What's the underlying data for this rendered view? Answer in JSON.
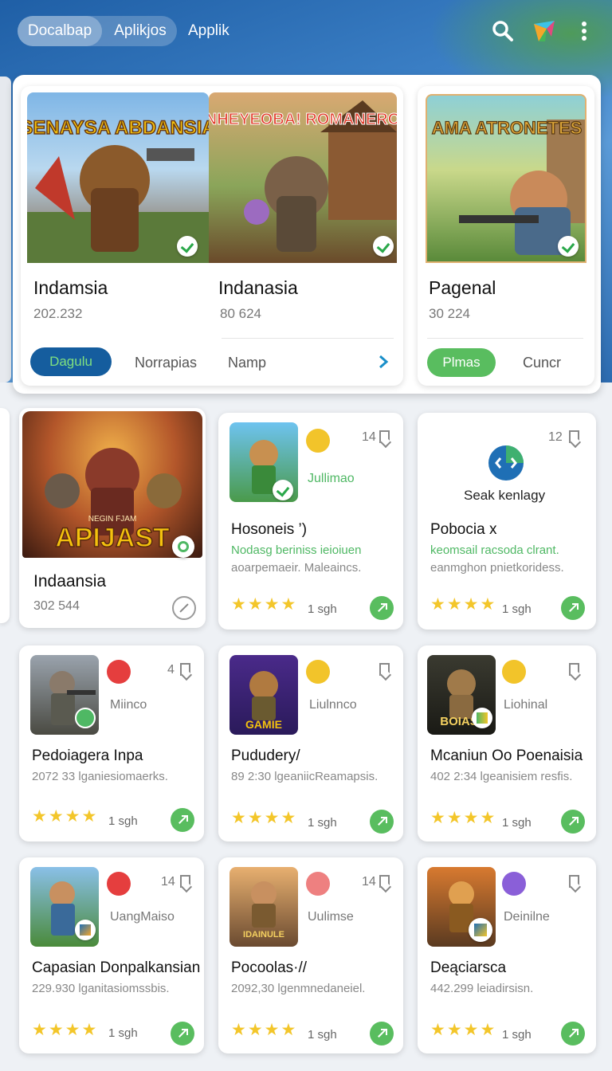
{
  "topbar": {
    "tab1": "Docalbap",
    "tab2": "Aplikjos",
    "tab3": "Applik",
    "icons": [
      "search-icon",
      "brand-icon",
      "more-icon"
    ]
  },
  "hero": {
    "items": [
      {
        "art_title": "SENAYSA ABDANSIA",
        "title": "Indamsia",
        "num": "202.232"
      },
      {
        "art_title": "NHEYEOBA! ROMANERO",
        "title": "Indanasia",
        "num": "80 624"
      },
      {
        "art_title": "AMA ATRONETES",
        "title": "Pagenal",
        "num": "30 224"
      }
    ],
    "actions": {
      "primary": "Dagulu",
      "link1": "Norrapias",
      "link2": "Namp",
      "primary2": "Plmas",
      "link3": "Cuncr"
    }
  },
  "featured": {
    "art_title": "APIJAST",
    "art_sub": "NEGIN FJAM",
    "title": "Indaansia",
    "num": "302 544"
  },
  "cards": [
    {
      "count": "14",
      "category": "Jullimao",
      "name": "Hosoneis ’)",
      "desc1": "Nodasg beriniss ieioiuen",
      "desc2": "aoarpemaeir. Maleaincs.",
      "ago": "1 sgh",
      "dot": "#f2c42a"
    },
    {
      "count": "12",
      "category": "Seak kenlagy",
      "name": "Pobocia x",
      "desc1": "keomsail racsoda clrant.",
      "desc2": "eanmghon pnietkoridess.",
      "ago": "1 sgh",
      "dot": "#1f6fb5"
    },
    {
      "count": "4",
      "category": "Miinco",
      "name": "Pedoiagera Inpa",
      "desc2": "2072 33 lganiesiomaerks.",
      "ago": "1 sgh",
      "dot": "#e53e3e"
    },
    {
      "count": "",
      "category": "Liulnnco",
      "name": "Pududery/",
      "desc2": "89 2:30 lgeaniicReamapsis.",
      "ago": "1 sgh",
      "dot": "#f2c42a",
      "art_title": "GAMIE"
    },
    {
      "count": "",
      "category": "Liohinal",
      "name": "Mcaniun Oo Poenaisia",
      "desc2": "402 2:34 lgeanisiem resfis.",
      "ago": "1 sgh",
      "dot": "#f2c42a",
      "art_title": "BOIAS"
    },
    {
      "count": "14",
      "category": "UangMaiso",
      "name": "Capasian Donpalkansian",
      "desc2": "229.930 lganitasiomssbis.",
      "ago": "1 sgh",
      "dot": "#e53e3e"
    },
    {
      "count": "14",
      "category": "Uulimse",
      "name": "Pocoolas·//",
      "desc2": "2092,30 lgenmnedaneiel.",
      "ago": "1 sgh",
      "dot": "#ee8080",
      "art_title": "IDAINULE"
    },
    {
      "count": "",
      "category": "Deinilne",
      "name": "Deąciarsca",
      "desc2": "442.299 leiadirsisn.",
      "ago": "1 sgh",
      "dot": "#8a5fd8"
    }
  ],
  "rating_stars": "★★★★",
  "colors": {
    "accent_blue": "#1a5ea0",
    "accent_green": "#4fb864",
    "star": "#f3c62a"
  }
}
